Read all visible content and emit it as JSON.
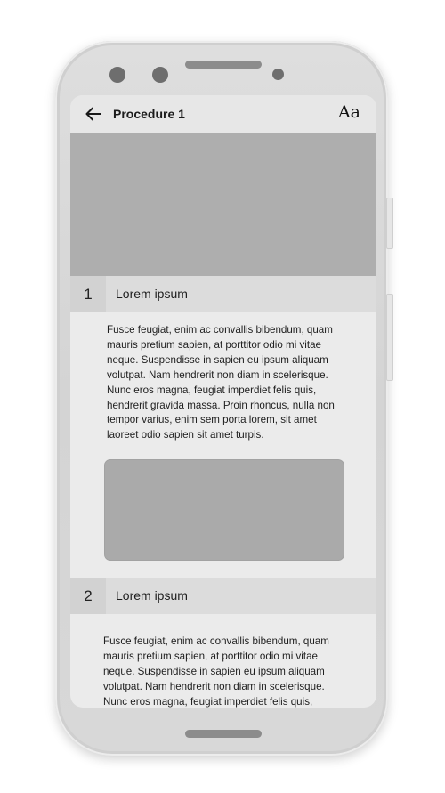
{
  "appbar": {
    "title": "Procedure 1",
    "font_button_label": "Aa"
  },
  "steps": [
    {
      "number": "1",
      "title": "Lorem ipsum",
      "body": "Fusce feugiat, enim ac convallis bibendum, quam mauris pretium sapien, at porttitor odio mi vitae neque. Suspendisse in sapien eu ipsum aliquam volutpat. Nam hendrerit non diam in scelerisque. Nunc eros magna, feugiat imperdiet felis quis, hendrerit gravida massa. Proin rhoncus, nulla non tempor varius, enim sem porta lorem, sit amet laoreet odio sapien sit amet turpis."
    },
    {
      "number": "2",
      "title": "Lorem ipsum",
      "body": "Fusce feugiat, enim ac convallis bibendum, quam mauris pretium sapien, at porttitor odio mi vitae neque. Suspendisse in sapien eu ipsum aliquam volutpat. Nam hendrerit non diam in scelerisque. Nunc eros magna, feugiat imperdiet felis quis,"
    }
  ],
  "colors": {
    "screen_background": "#ebebeb",
    "image_placeholder": "#aeaeae",
    "step_header": "#dcdcdc"
  }
}
